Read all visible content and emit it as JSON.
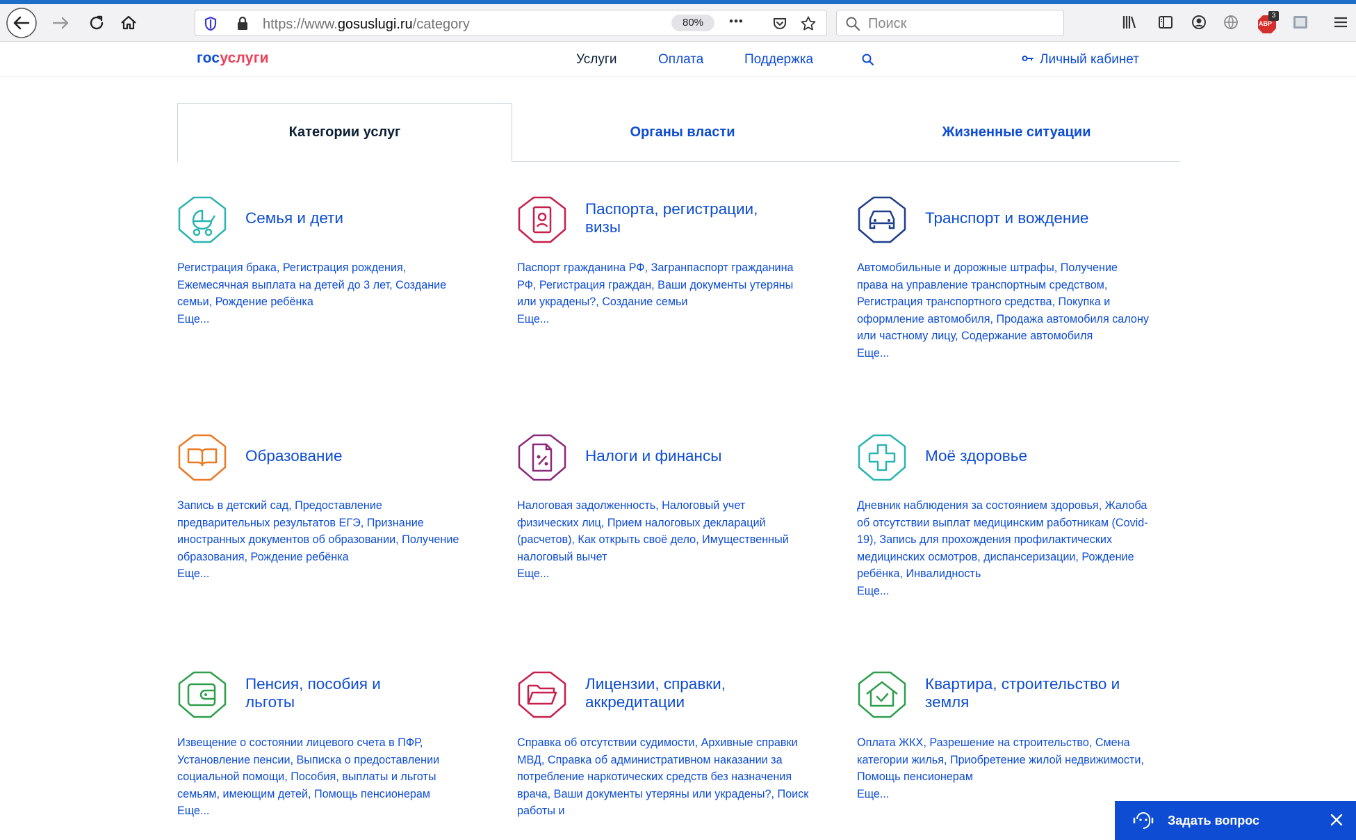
{
  "browser": {
    "url_prefix": "https://www.",
    "url_domain": "gosuslugi.ru",
    "url_path": "/category",
    "zoom": "80%",
    "more_label": "•••",
    "search_placeholder": "Поиск",
    "adblock_count": "3",
    "adblock_label": "ABP"
  },
  "site": {
    "logo_part1": "гос",
    "logo_part2": "услуги",
    "nav": [
      "Услуги",
      "Оплата",
      "Поддержка"
    ],
    "cabinet": "Личный кабинет"
  },
  "tabs": [
    "Категории услуг",
    "Органы власти",
    "Жизненные ситуации"
  ],
  "more_link": "Еще...",
  "categories": [
    {
      "icon": "stroller-icon",
      "color": "#2ab5b0",
      "title": "Семья и дети",
      "description": "Регистрация брака, Регистрация рождения, Ежемесячная выплата на детей до 3 лет, Создание семьи, Рождение ребёнка"
    },
    {
      "icon": "passport-icon",
      "color": "#c71f4b",
      "title": "Паспорта, регистрации, визы",
      "description": "Паспорт гражданина РФ, Загранпаспорт гражданина РФ, Регистрация граждан, Ваши документы утеряны или украдены?, Создание семьи"
    },
    {
      "icon": "car-icon",
      "color": "#1f3d8a",
      "title": "Транспорт и вождение",
      "description": "Автомобильные и дорожные штрафы, Получение права на управление транспортным средством, Регистрация транспортного средства, Покупка и оформление автомобиля, Продажа автомобиля салону или частному лицу, Содержание автомобиля"
    },
    {
      "icon": "book-icon",
      "color": "#ea7a24",
      "title": "Образование",
      "description": "Запись в детский сад, Предоставление предварительных результатов ЕГЭ, Признание иностранных документов об образовании, Получение образования, Рождение ребёнка"
    },
    {
      "icon": "tax-document-icon",
      "color": "#8b2a7a",
      "title": "Налоги и финансы",
      "description": "Налоговая задолженность, Налоговый учет физических лиц, Прием налоговых деклараций (расчетов), Как открыть своё дело, Имущественный налоговый вычет"
    },
    {
      "icon": "medical-cross-icon",
      "color": "#2ab5b0",
      "title": "Моё здоровье",
      "description": "Дневник наблюдения за состоянием здоровья, Жалоба об отсутствии выплат медицинским работникам (Covid-19), Запись для прохождения профилактических медицинских осмотров, диспансеризации, Рождение ребёнка, Инвалидность"
    },
    {
      "icon": "wallet-icon",
      "color": "#2e9e4a",
      "title": "Пенсия, пособия и льготы",
      "description": "Извещение о состоянии лицевого счета в ПФР, Установление пенсии, Выписка о предоставлении социальной помощи, Пособия, выплаты и льготы семьям, имеющим детей, Помощь пенсионерам"
    },
    {
      "icon": "folder-icon",
      "color": "#c71f4b",
      "title": "Лицензии, справки, аккредитации",
      "description": "Справка об отсутствии судимости, Архивные справки МВД, Справка об административном наказании за потребление наркотических средств без назначения врача, Ваши документы утеряны или украдены?, Поиск работы и"
    },
    {
      "icon": "house-icon",
      "color": "#2e9e4a",
      "title": "Квартира, строительство и земля",
      "description": "Оплата ЖКХ, Разрешение на строительство, Смена категории жилья, Приобретение жилой недвижимости, Помощь пенсионерам"
    }
  ],
  "chat": {
    "label": "Задать вопрос"
  }
}
